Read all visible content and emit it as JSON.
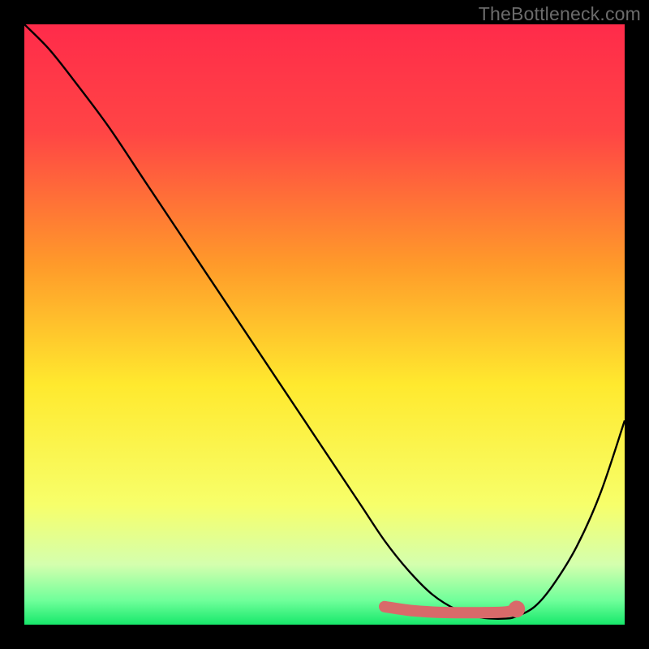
{
  "watermark": "TheBottleneck.com",
  "chart_data": {
    "type": "line",
    "title": "",
    "xlabel": "",
    "ylabel": "",
    "xlim": [
      0,
      100
    ],
    "ylim": [
      0,
      100
    ],
    "gradient_stops": [
      {
        "offset": 0,
        "color": "#ff2b4a"
      },
      {
        "offset": 18,
        "color": "#ff4545"
      },
      {
        "offset": 40,
        "color": "#ff9a2a"
      },
      {
        "offset": 60,
        "color": "#ffe92e"
      },
      {
        "offset": 80,
        "color": "#f7ff6a"
      },
      {
        "offset": 90,
        "color": "#d4ffae"
      },
      {
        "offset": 96,
        "color": "#6fff9a"
      },
      {
        "offset": 100,
        "color": "#17e86b"
      }
    ],
    "series": [
      {
        "name": "bottleneck-curve",
        "color": "#000000",
        "x": [
          0,
          4,
          8,
          14,
          20,
          26,
          32,
          38,
          44,
          50,
          56,
          60,
          64,
          68,
          72,
          76,
          80,
          82,
          85,
          88,
          92,
          96,
          100
        ],
        "y": [
          100,
          96,
          91,
          83,
          74,
          65,
          56,
          47,
          38,
          29,
          20,
          14,
          9,
          5,
          2.5,
          1.2,
          1,
          1.4,
          3,
          6.5,
          13,
          22,
          34
        ]
      }
    ],
    "highlight_band": {
      "name": "optimal-range",
      "color": "#d86a6a",
      "x": [
        60,
        64,
        68,
        72,
        76,
        80,
        82
      ],
      "y": [
        3.0,
        2.4,
        2.1,
        2.0,
        2.0,
        2.1,
        2.5
      ]
    },
    "highlight_dot": {
      "name": "marker",
      "color": "#d86a6a",
      "x": 82,
      "y": 2.6,
      "r": 1.4
    }
  }
}
